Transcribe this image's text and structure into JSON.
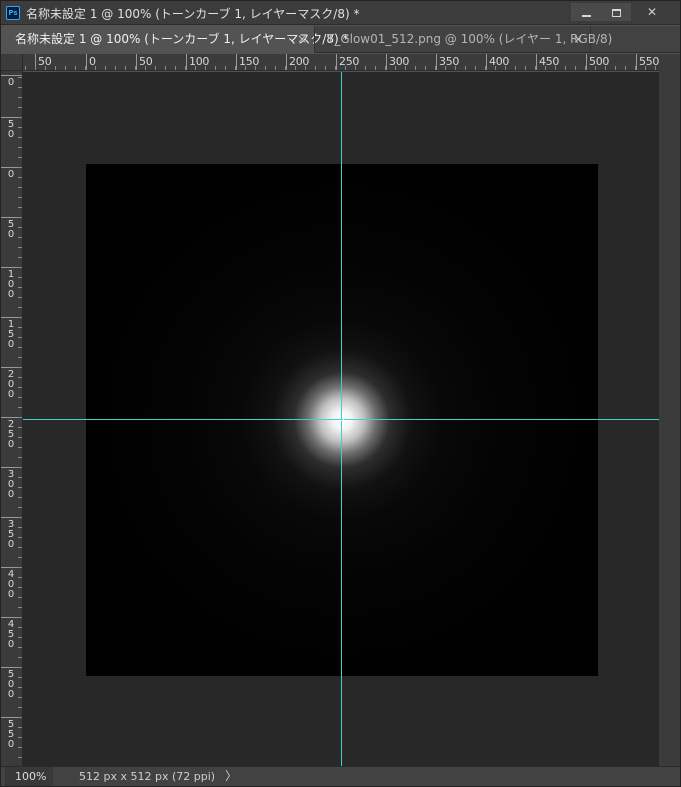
{
  "window": {
    "title": "名称未設定 1 @ 100% (トーンカーブ 1, レイヤーマスク/8) *",
    "app_icon": "Ps",
    "controls": {
      "minimize": "minimize-icon",
      "maximize": "maximize-icon",
      "close": "✕"
    }
  },
  "tabs": [
    {
      "label": "名称未設定 1 @ 100% (トーンカーブ 1, レイヤーマスク/8) *",
      "close": "×",
      "active": true
    },
    {
      "label": "T_Glow01_512.png @ 100% (レイヤー 1, RGB/8)",
      "close": "×",
      "active": false
    }
  ],
  "ruler_top": {
    "labels": [
      "50",
      "0",
      "50",
      "100",
      "150",
      "200",
      "250",
      "300",
      "350",
      "400",
      "450",
      "500",
      "550"
    ]
  },
  "ruler_left": {
    "labels": [
      "0",
      "5\n0",
      "0",
      "5\n0",
      "1\n0\n0",
      "1\n5\n0",
      "2\n0\n0",
      "2\n5\n0",
      "3\n0\n0",
      "3\n5\n0",
      "4\n0\n0",
      "4\n5\n0",
      "5\n0\n0",
      "5\n5\n0"
    ]
  },
  "status": {
    "zoom": "100%",
    "doc_info": "512 px x 512 px (72 ppi)",
    "arrow": "〉"
  },
  "colors": {
    "guide": "#3fd0d0",
    "pasteboard": "#282828",
    "canvas": "#000000"
  }
}
